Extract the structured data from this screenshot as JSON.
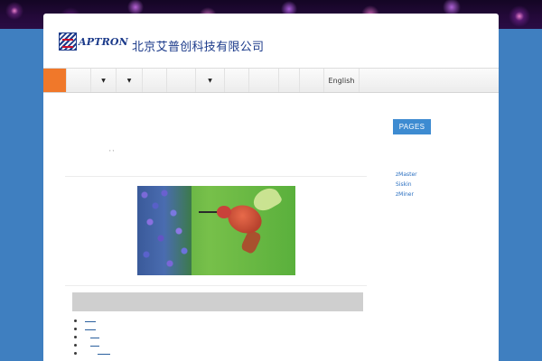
{
  "header": {
    "logo_text": "APTRON",
    "company_name": "北京艾普创科技有限公司"
  },
  "nav": {
    "language": "English"
  },
  "sidebar": {
    "heading": "PAGES",
    "links": [
      "zMaster",
      "Siskin",
      "zMiner"
    ]
  },
  "content": {
    "meta_text": ", ,",
    "image_subject": "hummingbird with purple flowers"
  },
  "colors": {
    "background": "#3f7fc0",
    "nav_home": "#f0782a",
    "sidebar_heading": "#3d8bd1",
    "link": "#2a6fc0"
  }
}
